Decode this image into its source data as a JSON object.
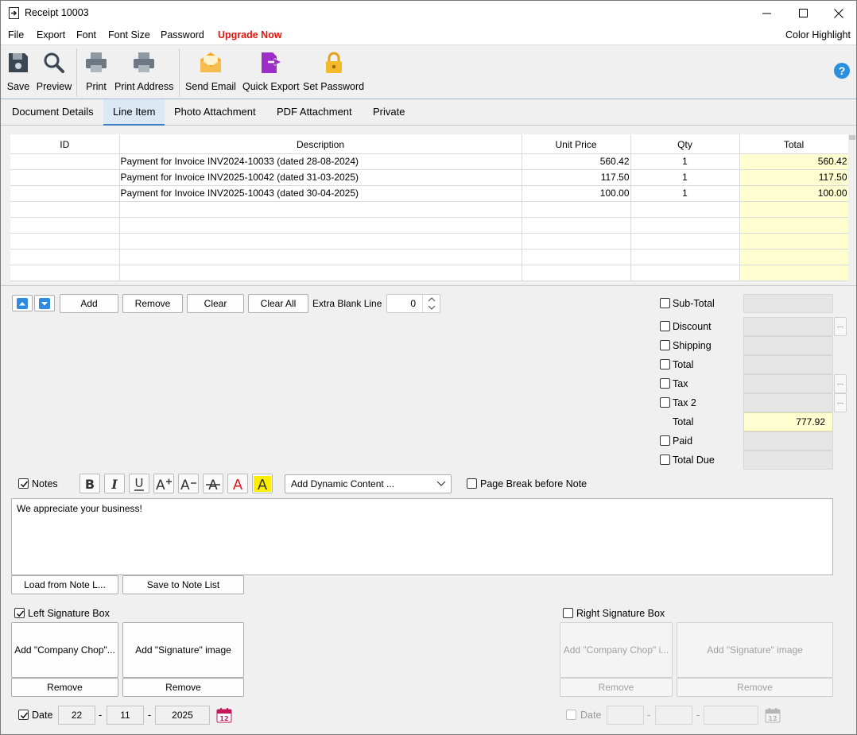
{
  "window": {
    "title": "Receipt 10003",
    "minimize_glyph": "—",
    "maximize_glyph": "☐",
    "close_glyph": "✕"
  },
  "menu": {
    "file": "File",
    "export": "Export",
    "font": "Font",
    "font_size": "Font Size",
    "password": "Password",
    "upgrade": "Upgrade Now",
    "color_highlight": "Color Highlight"
  },
  "toolbar": {
    "save": "Save",
    "preview": "Preview",
    "print": "Print",
    "print_address": "Print Address",
    "send_email": "Send Email",
    "quick_export": "Quick Export",
    "set_password": "Set Password"
  },
  "tabs": [
    {
      "label": "Document Details",
      "active": false
    },
    {
      "label": "Line Item",
      "active": true
    },
    {
      "label": "Photo Attachment",
      "active": false
    },
    {
      "label": "PDF Attachment",
      "active": false
    },
    {
      "label": "Private",
      "active": false
    }
  ],
  "grid": {
    "columns": [
      "ID",
      "Description",
      "Unit Price",
      "Qty",
      "Total"
    ],
    "rows": [
      {
        "id": "",
        "description": "Payment for Invoice INV2024-10033 (dated 28-08-2024)",
        "unit_price": "560.42",
        "qty": "1",
        "total": "560.42"
      },
      {
        "id": "",
        "description": "Payment for Invoice INV2025-10042 (dated 31-03-2025)",
        "unit_price": "117.50",
        "qty": "1",
        "total": "117.50"
      },
      {
        "id": "",
        "description": "Payment for Invoice INV2025-10043 (dated 30-04-2025)",
        "unit_price": "100.00",
        "qty": "1",
        "total": "100.00"
      },
      {
        "id": "",
        "description": "",
        "unit_price": "",
        "qty": "",
        "total": ""
      },
      {
        "id": "",
        "description": "",
        "unit_price": "",
        "qty": "",
        "total": ""
      },
      {
        "id": "",
        "description": "",
        "unit_price": "",
        "qty": "",
        "total": ""
      },
      {
        "id": "",
        "description": "",
        "unit_price": "",
        "qty": "",
        "total": ""
      },
      {
        "id": "",
        "description": "",
        "unit_price": "",
        "qty": "",
        "total": ""
      }
    ]
  },
  "line_actions": {
    "add": "Add",
    "remove": "Remove",
    "clear": "Clear",
    "clear_all": "Clear All",
    "extra_blank_line_label": "Extra Blank Line",
    "extra_blank_line_value": "0"
  },
  "summary": {
    "sub_total": "Sub-Total",
    "discount": "Discount",
    "shipping": "Shipping",
    "total_check": "Total",
    "tax": "Tax",
    "tax2": "Tax 2",
    "total_label": "Total",
    "total_value": "777.92",
    "paid": "Paid",
    "total_due": "Total Due",
    "dots": "..."
  },
  "notes": {
    "label": "Notes",
    "checked": true,
    "format_buttons": [
      "bold-icon",
      "italic-icon",
      "underline-icon",
      "increase-font-icon",
      "decrease-font-icon",
      "strikethrough-icon",
      "font-color-icon",
      "highlight-color-icon"
    ],
    "dynamic_content": "Add Dynamic Content ...",
    "page_break": "Page Break before Note",
    "text": "We appreciate your business!",
    "load_button": "Load from Note L...",
    "save_button": "Save to Note List"
  },
  "signatures": {
    "left_label": "Left Signature Box",
    "left_checked": true,
    "right_label": "Right Signature Box",
    "right_checked": false,
    "add_chop_left": "Add \"Company Chop\"...",
    "add_sig_left": "Add \"Signature\" image",
    "add_chop_right": "Add \"Company Chop\" i...",
    "add_sig_right": "Add \"Signature\" image",
    "remove": "Remove"
  },
  "date": {
    "label": "Date",
    "left_checked": true,
    "day": "22",
    "month": "11",
    "year": "2025",
    "separator": "-",
    "right_label": "Date"
  },
  "colors": {
    "accent": "#3c7fc1",
    "upgrade": "#e0140c",
    "total_bg": "#fefed0",
    "email_icon": "#f5a623",
    "export_icon": "#9b2fc7",
    "lock_icon": "#f2b92b",
    "help_icon": "#2b8fe0"
  }
}
